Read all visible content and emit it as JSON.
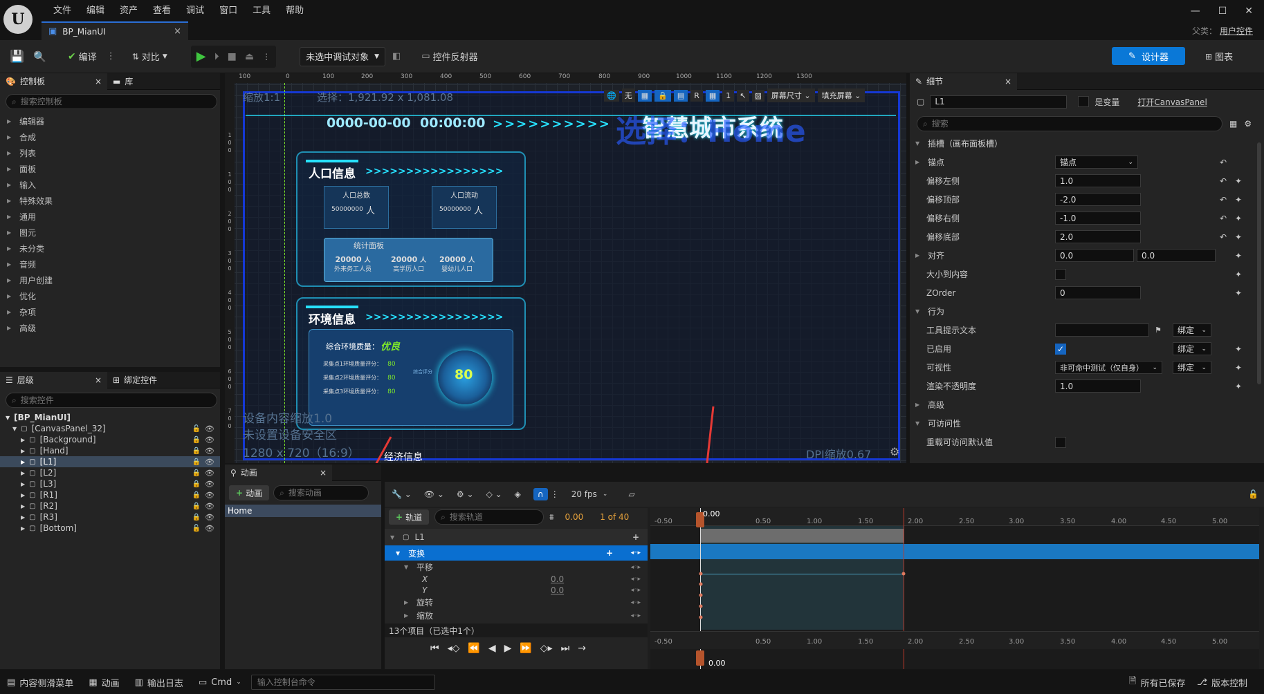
{
  "menu": [
    "文件",
    "编辑",
    "资产",
    "查看",
    "调试",
    "窗口",
    "工具",
    "帮助"
  ],
  "doc_tab": "BP_MianUI",
  "parent_label": "父类：",
  "parent_value": "用户控件",
  "toolbar": {
    "compile": "编译",
    "diff": "对比",
    "debug_target": "未选中调试对象",
    "reflector": "控件反射器",
    "designer": "设计器",
    "graph": "图表"
  },
  "palette": {
    "tab1": "控制板",
    "tab2": "库",
    "search_placeholder": "搜索控制板",
    "categories": [
      "编辑器",
      "合成",
      "列表",
      "面板",
      "输入",
      "特殊效果",
      "通用",
      "图元",
      "未分类",
      "音频",
      "用户创建",
      "优化",
      "杂项",
      "高级"
    ]
  },
  "hierarchy": {
    "tab1": "层级",
    "tab2": "绑定控件",
    "search_placeholder": "搜索控件",
    "root": "[BP_MianUI]",
    "canvas": "[CanvasPanel_32]",
    "children": [
      "[Background]",
      "[Hand]",
      "[L1]",
      "[L2]",
      "[L3]",
      "[R1]",
      "[R2]",
      "[R3]",
      "[Bottom]"
    ]
  },
  "designer": {
    "zoom": "缩放1:1",
    "selection": "选择：1,921.92 x 1,081.08",
    "ruler": [
      "100",
      "0",
      "100",
      "200",
      "300",
      "400",
      "500",
      "600",
      "700",
      "800",
      "900",
      "1000",
      "1100",
      "1200",
      "1300"
    ],
    "vruler": [
      "1",
      "0",
      "0",
      "1",
      "0",
      "0",
      "2",
      "0",
      "0",
      "3",
      "0",
      "0",
      "4",
      "0",
      "0",
      "5",
      "0",
      "0",
      "6",
      "0",
      "0",
      "7",
      "0",
      "0"
    ],
    "view_none": "无",
    "view_r": "R",
    "view_1": "1",
    "screen_size": "屏幕尺寸",
    "fill_screen": "填充屏幕",
    "dpi_scale": "DPI缩放0.67",
    "device_scale": "设备内容缩放1.0",
    "safe_zone": "未设置设备安全区",
    "resolution": "1280 x 720（16:9）",
    "ui": {
      "date": "0000-00-00",
      "time": "00:00:00",
      "arrows_top": ">>>>>>>>>>",
      "big_title": "智慧城市系统",
      "overlay_title": "选择：Home",
      "pop_title": "人口信息",
      "pop_arrows": ">>>>>>>>>>>>>>>>>",
      "pop_total_label": "人口总数",
      "pop_total_val": "50000000",
      "pop_unit": "人",
      "pop_flow_label": "人口流动",
      "pop_flow_val": "50000000",
      "stats_title": "统计面板",
      "stats": [
        {
          "val": "20000",
          "unit": "人",
          "label": "外来务工人员"
        },
        {
          "val": "20000",
          "unit": "人",
          "label": "高学历人口"
        },
        {
          "val": "20000",
          "unit": "人",
          "label": "婴幼儿人口"
        }
      ],
      "env_title": "环境信息",
      "env_arrows": ">>>>>>>>>>>>>>>>>",
      "env_quality_label": "综合环境质量：",
      "env_quality_val": "优良",
      "env_rows": [
        {
          "label": "采集点1环境质量评分：",
          "val": "80"
        },
        {
          "label": "采集点2环境质量评分：",
          "val": "80"
        },
        {
          "label": "采集点3环境质量评分：",
          "val": "80"
        }
      ],
      "gauge_label": "综合评分",
      "gauge_val": "80",
      "next_title": "经济信息"
    }
  },
  "details": {
    "tab": "细节",
    "name": "L1",
    "is_variable": "是变量",
    "open_canvas": "打开CanvasPanel",
    "search_placeholder": "搜索",
    "section_slot": "插槽（画布面板槽）",
    "anchor_label": "锚点",
    "anchor_val": "锚点",
    "offset_left_label": "偏移左侧",
    "offset_left": "1.0",
    "offset_top_label": "偏移顶部",
    "offset_top": "-2.0",
    "offset_right_label": "偏移右侧",
    "offset_right": "-1.0",
    "offset_bottom_label": "偏移底部",
    "offset_bottom": "2.0",
    "align_label": "对齐",
    "align_x": "0.0",
    "align_y": "0.0",
    "size_to_content": "大小到内容",
    "zorder_label": "ZOrder",
    "zorder": "0",
    "section_behavior": "行为",
    "tooltip_label": "工具提示文本",
    "bind": "绑定",
    "enabled_label": "已启用",
    "visibility_label": "可视性",
    "visibility_val": "非可命中测试（仅自身）",
    "opacity_label": "渲染不透明度",
    "opacity": "1.0",
    "advanced": "高级",
    "section_access": "可访问性",
    "override_access": "重载可访问默认值"
  },
  "animation": {
    "tab": "动画",
    "add_btn": "动画",
    "search_placeholder": "搜索动画",
    "items": [
      "Home"
    ]
  },
  "sequencer": {
    "fps": "20 fps",
    "track_btn": "轨道",
    "search_placeholder": "搜索轨道",
    "current_time": "0.00",
    "frame_info": "1 of 40",
    "tracks": {
      "l1": "L1",
      "transform": "变换",
      "translate": "平移",
      "x_label": "X",
      "x_val": "0.0",
      "y_label": "Y",
      "y_val": "0.0",
      "rotate": "旋转",
      "scale": "缩放"
    },
    "item_count": "13个项目（已选中1个）",
    "ruler": [
      "-0.50",
      "0.50",
      "1.00",
      "1.50",
      "2.00",
      "2.50",
      "3.00",
      "3.50",
      "4.00",
      "4.50",
      "5.00"
    ],
    "playhead_label": "0.00"
  },
  "statusbar": {
    "content_drawer": "内容侧滑菜单",
    "animation": "动画",
    "output_log": "输出日志",
    "cmd": "Cmd",
    "cmd_placeholder": "输入控制台命令",
    "saved": "所有已保存",
    "source_control": "版本控制"
  },
  "colors": {
    "accent_blue": "#0a84e0",
    "selected_row": "#0a6fd0",
    "ui_cyan": "#27e1ff",
    "ui_green": "#7ee82a",
    "red_arrow": "#e53935"
  }
}
